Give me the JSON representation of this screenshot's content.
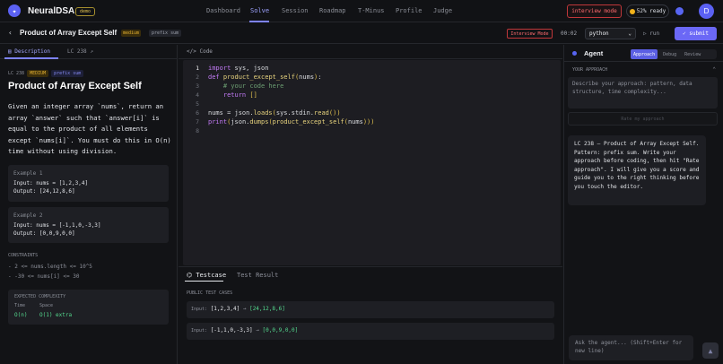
{
  "app": {
    "name": "NeuralDSA",
    "badge": "demo",
    "logo_icon": "neural-icon"
  },
  "nav": [
    "Dashboard",
    "Solve",
    "Session",
    "Roadmap",
    "T-Minus",
    "Profile",
    "Judge"
  ],
  "header": {
    "interview_mode": "interview mode",
    "ready": "52% ready",
    "avatar": "D"
  },
  "problem": {
    "title": "Product of Array Except Self",
    "difficulty": "medium",
    "pattern": "prefix sum",
    "interview_badge": "Interview Mode",
    "timer": "00:02",
    "language": "python",
    "run": "run",
    "submit": "submit",
    "tabs": [
      "Description",
      "LC 238"
    ],
    "id": "LC 238",
    "difficulty_caps": "MEDIUM",
    "description": "Given an integer array `nums`, return an array `answer` such that `answer[i]` is equal to the product of all elements except `nums[i]`. You must do this in O(n) time without using division.",
    "examples": [
      {
        "title": "Example 1",
        "input": "Input:  nums = [1,2,3,4]",
        "output": "Output: [24,12,8,6]"
      },
      {
        "title": "Example 2",
        "input": "Input:  nums = [-1,1,0,-3,3]",
        "output": "Output: [0,0,9,0,0]"
      }
    ],
    "constraints_title": "CONSTRAINTS",
    "constraints": [
      "- 2 <= nums.length <= 10^5",
      "- -30 <= nums[i] <= 30"
    ],
    "complexity": {
      "title": "EXPECTED COMPLEXITY",
      "time_label": "Time",
      "time": "O(n)",
      "space_label": "Space",
      "space": "O(1) extra"
    }
  },
  "editor": {
    "label": "Code",
    "line_numbers": [
      "1",
      "2",
      "3",
      "4",
      "5",
      "6",
      "7",
      "8"
    ],
    "lines": [
      "import sys, json",
      "def product_except_self(nums):",
      "    # your code here",
      "    return []",
      "",
      "nums = json.loads(sys.stdin.read())",
      "print(json.dumps(product_except_self(nums)))",
      ""
    ]
  },
  "bottom": {
    "tabs": [
      "Testcase",
      "Test Result"
    ],
    "public_title": "PUBLIC TEST CASES",
    "cases": [
      {
        "label": "Input:",
        "input": "[1,2,3,4]",
        "arrow": "→",
        "output": "[24,12,8,6]"
      },
      {
        "label": "Input:",
        "input": "[-1,1,0,-3,3]",
        "arrow": "→",
        "output": "[0,0,9,0,0]"
      }
    ]
  },
  "agent": {
    "title": "Agent",
    "modes": [
      "Approach",
      "Debug",
      "Review"
    ],
    "your_approach": "YOUR APPROACH",
    "placeholder": "Describe your approach: pattern, data structure, time complexity...",
    "rate_button": "Rate my approach",
    "message": "LC 238 — Product of Array Except Self. Pattern: prefix sum. Write your approach before coding, then hit \"Rate approach\". I will give you a score and guide you to the right thinking before you touch the editor.",
    "chat_placeholder": "Ask the agent... (Shift+Enter for new line)"
  }
}
